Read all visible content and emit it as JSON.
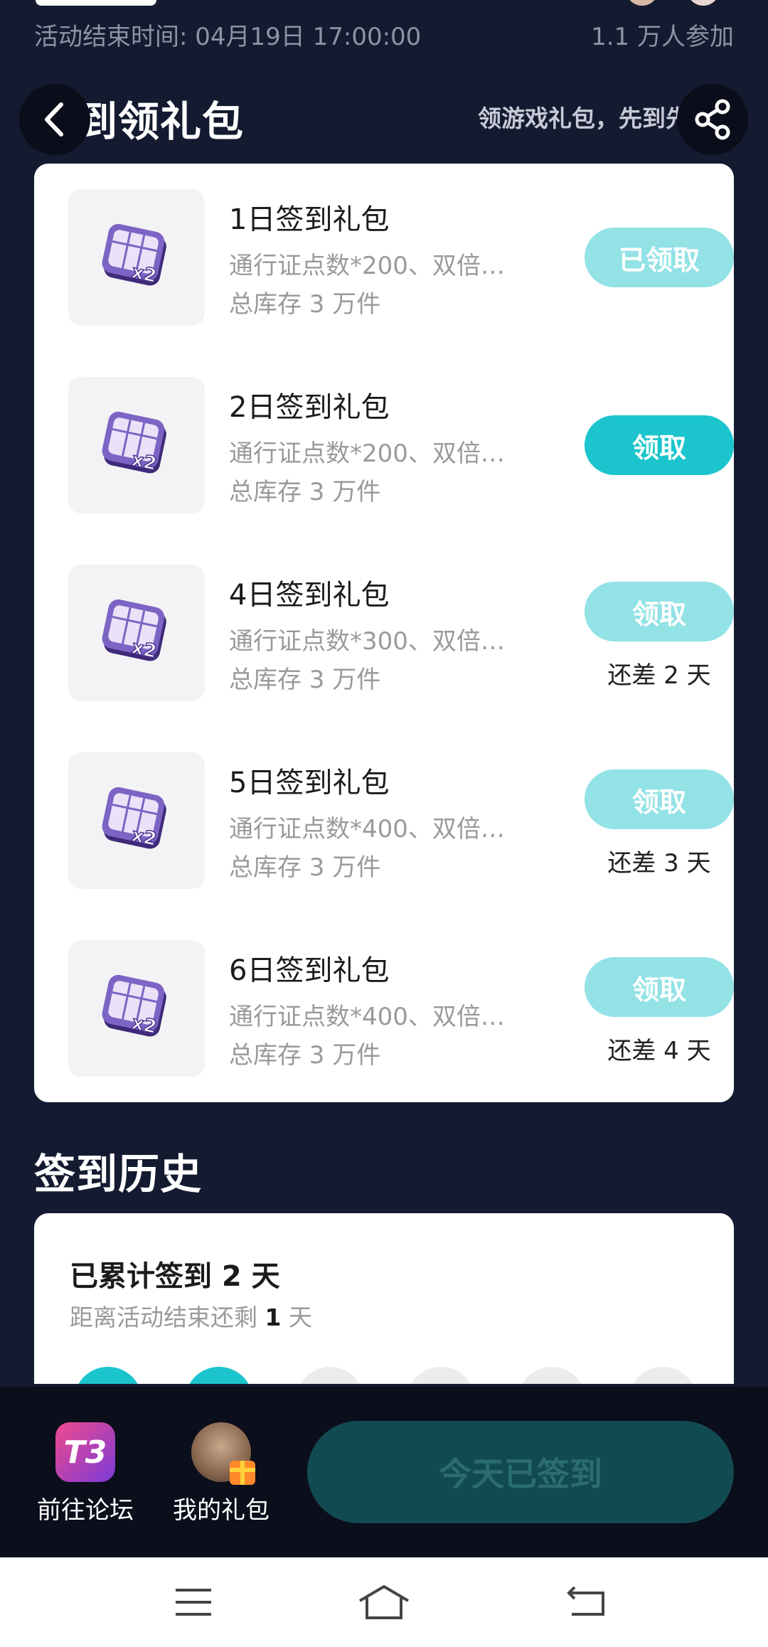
{
  "activity": {
    "end_time": "活动结束时间: 04月19日 17:00:00",
    "participants": "1.1 万人参加"
  },
  "header": {
    "title": "签到领礼包",
    "tip": "领游戏礼包，先到先得"
  },
  "gifts": [
    {
      "title": "1日签到礼包",
      "desc": "通行证点数*200、双倍…",
      "stock": "总库存 3 万件",
      "button": "已领取",
      "remain": ""
    },
    {
      "title": "2日签到礼包",
      "desc": "通行证点数*200、双倍…",
      "stock": "总库存 3 万件",
      "button": "领取",
      "remain": ""
    },
    {
      "title": "4日签到礼包",
      "desc": "通行证点数*300、双倍…",
      "stock": "总库存 3 万件",
      "button": "领取",
      "remain": "还差 2 天"
    },
    {
      "title": "5日签到礼包",
      "desc": "通行证点数*400、双倍…",
      "stock": "总库存 3 万件",
      "button": "领取",
      "remain": "还差 3 天"
    },
    {
      "title": "6日签到礼包",
      "desc": "通行证点数*400、双倍…",
      "stock": "总库存 3 万件",
      "button": "领取",
      "remain": "还差 4 天"
    }
  ],
  "history": {
    "title": "签到历史",
    "total": "已累计签到 2 天",
    "remain_prefix": "距离活动结束还剩 ",
    "remain_days": "1",
    "remain_suffix": " 天"
  },
  "bottom": {
    "forum_label": "前往论坛",
    "forum_logo_text": "T3",
    "gifts_label": "我的礼包",
    "signed_label": "今天已签到"
  },
  "colors": {
    "accent": "#1cc5cd",
    "accent_faded": "#92e2e6",
    "background": "#141a30"
  },
  "icons": {
    "back": "chevron-left-icon",
    "share": "share-icon",
    "gift_ticket": "pass-ticket-x2-icon",
    "nav_menu": "menu-icon",
    "nav_home": "home-icon",
    "nav_back": "back-icon"
  }
}
